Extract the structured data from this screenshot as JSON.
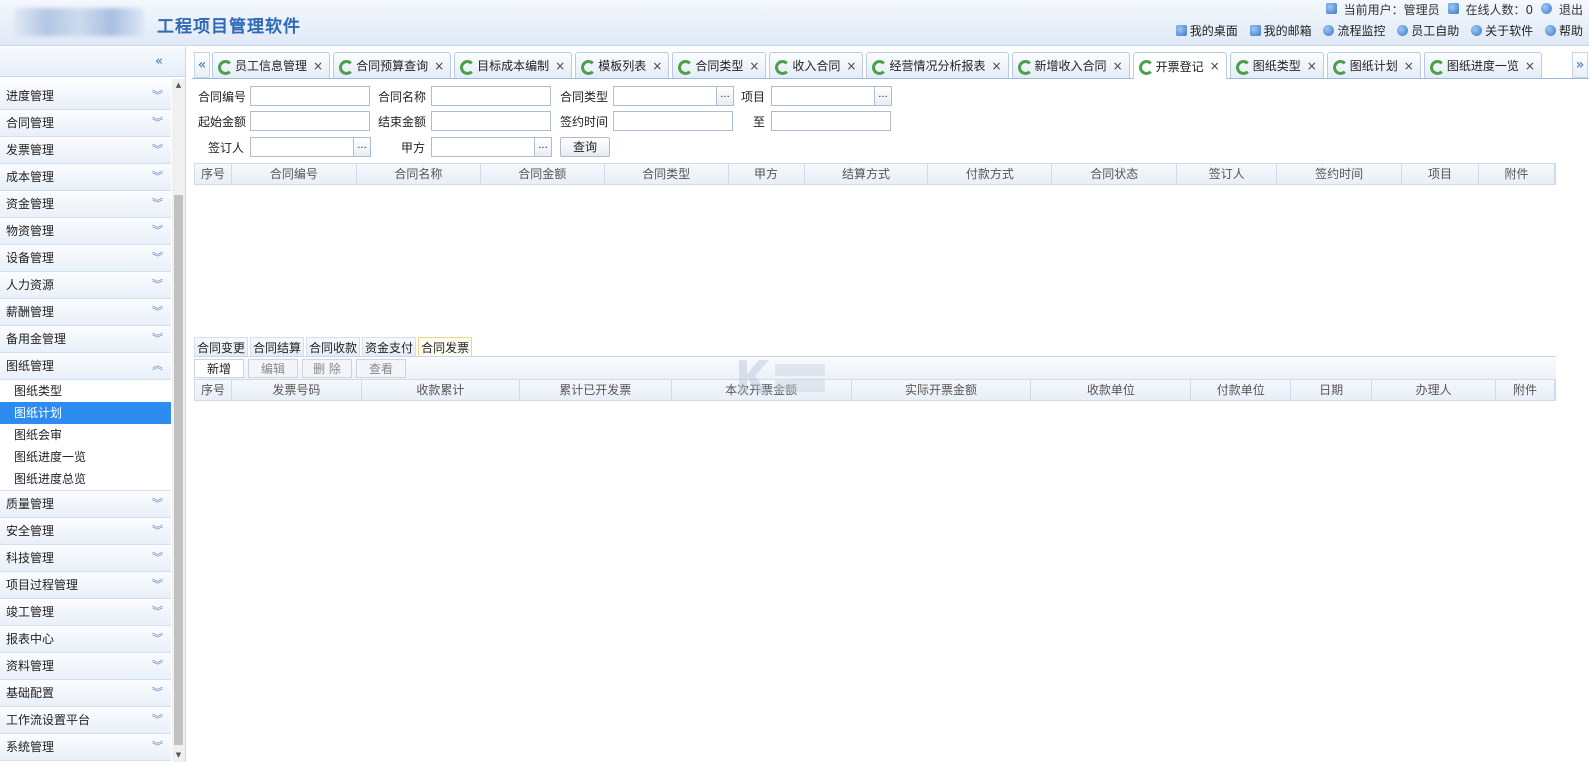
{
  "app": {
    "title": "工程项目管理软件",
    "current_user_label": "当前用户：管理员",
    "online_label": "在线人数：0",
    "logout": "退出"
  },
  "topnav": [
    "我的桌面",
    "我的邮箱",
    "流程监控",
    "员工自助",
    "关于软件",
    "帮助"
  ],
  "sidebar": {
    "menu_before": [
      "进度管理",
      "合同管理",
      "发票管理",
      "成本管理",
      "资金管理",
      "物资管理",
      "设备管理",
      "人力资源",
      "薪酬管理",
      "备用金管理"
    ],
    "expanded": {
      "label": "图纸管理",
      "items": [
        "图纸类型",
        "图纸计划",
        "图纸会审",
        "图纸进度一览",
        "图纸进度总览"
      ],
      "active_index": 1
    },
    "menu_after": [
      "质量管理",
      "安全管理",
      "科技管理",
      "项目过程管理",
      "竣工管理",
      "报表中心",
      "资料管理",
      "基础配置",
      "工作流设置平台",
      "系统管理"
    ]
  },
  "tabs": {
    "items": [
      "员工信息管理",
      "合同预算查询",
      "目标成本编制",
      "模板列表",
      "合同类型",
      "收入合同",
      "经营情况分析报表",
      "新增收入合同",
      "开票登记",
      "图纸类型",
      "图纸计划",
      "图纸进度一览"
    ],
    "active_index": 8,
    "close_glyph": "×"
  },
  "form": {
    "contract_no": "合同编号",
    "contract_name": "合同名称",
    "contract_type": "合同类型",
    "project": "项目",
    "start_amount": "起始金额",
    "end_amount": "结束金额",
    "sign_time": "签约时间",
    "to": "至",
    "signer": "签订人",
    "party_a": "甲方",
    "dots": "...",
    "query_button": "查询"
  },
  "grid1": {
    "headers": [
      "序号",
      "合同编号",
      "合同名称",
      "合同金额",
      "合同类型",
      "甲方",
      "结算方式",
      "付款方式",
      "合同状态",
      "签订人",
      "签约时间",
      "项目",
      "附件"
    ]
  },
  "subtabs": {
    "items": [
      "合同变更",
      "合同结算",
      "合同收款",
      "资金支付",
      "合同发票"
    ],
    "active_index": 4
  },
  "toolbar": {
    "add": "新增",
    "edit": "编辑",
    "delete": "删 除",
    "view": "查看"
  },
  "grid2": {
    "headers": [
      "序号",
      "发票号码",
      "收款累计",
      "累计已开发票",
      "本次开票金额",
      "实际开票金额",
      "收款单位",
      "付款单位",
      "日期",
      "办理人",
      "附件"
    ]
  },
  "colors": {
    "accent": "#2d8cf0",
    "title": "#2e69b5",
    "border": "#c7d6ea"
  }
}
